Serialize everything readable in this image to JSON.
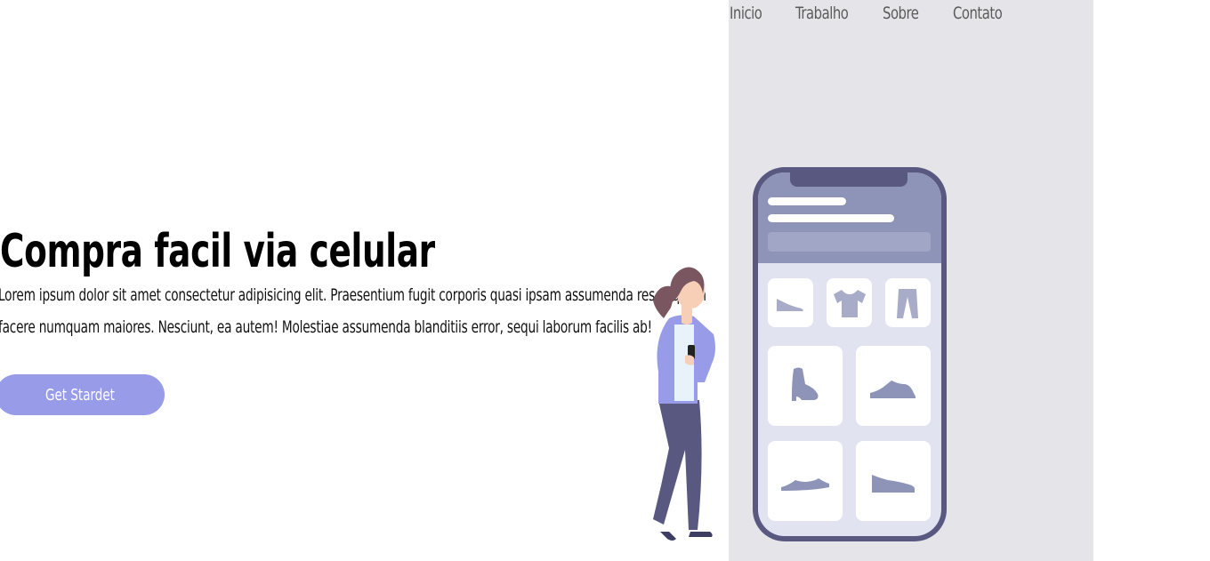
{
  "nav": {
    "items": [
      {
        "label": "Inicio"
      },
      {
        "label": "Trabalho"
      },
      {
        "label": "Sobre"
      },
      {
        "label": "Contato"
      }
    ]
  },
  "hero": {
    "title": "Compra facil via celular",
    "text": "Lorem ipsum dolor sit amet consectetur adipisicing elit. Praesentium fugit corporis quasi ipsam assumenda res aliquam facere numquam maiores. Nesciunt, ea autem! Molestiae assumenda blanditiis error, sequi laborum facilis ab!",
    "cta_label": "Get Stardet"
  },
  "illustration": {
    "icons": [
      "shoe-icon",
      "tshirt-icon",
      "pants-icon",
      "boot-icon",
      "sneaker-icon",
      "shoe-low-icon",
      "shoe-flat-icon"
    ]
  },
  "colors": {
    "panel_bg": "#e5e4e9",
    "accent": "#979be8",
    "phone_frame": "#585880",
    "phone_header": "#8e94b8"
  }
}
